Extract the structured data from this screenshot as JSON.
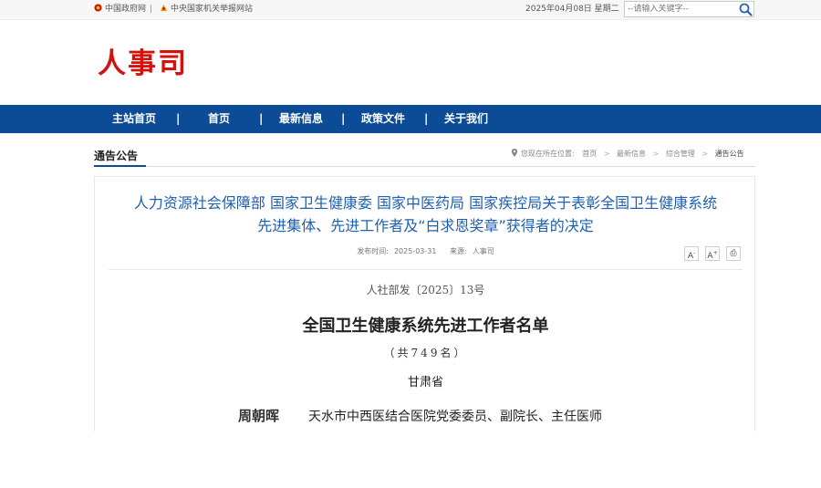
{
  "topbar": {
    "gov_link": "中国政府网",
    "separator": "|",
    "report_link": "中央国家机关举报网站",
    "date": "2025年04月08日 星期二",
    "search": {
      "placeholder": "--请输入关键字--"
    }
  },
  "header": {
    "logo_text": "人事司"
  },
  "nav": {
    "items": [
      {
        "label": "主站首页"
      },
      {
        "label": "首页"
      },
      {
        "label": "最新信息"
      },
      {
        "label": "政策文件"
      },
      {
        "label": "关于我们"
      }
    ],
    "separator": "|"
  },
  "section": {
    "title": "通告公告",
    "breadcrumb": {
      "prefix": "您现在所在位置:",
      "items": [
        "首页",
        "最新信息",
        "综合管理"
      ],
      "current": "通告公告",
      "arrow": ">"
    }
  },
  "article": {
    "title_line1": "人力资源社会保障部 国家卫生健康委 国家中医药局 国家疾控局关于表彰全国卫生健康系统",
    "title_line2": "先进集体、先进工作者及“白求恩奖章”获得者的决定",
    "published_label": "发布时间:",
    "published_date": "2025-03-31",
    "source_label": "来源:",
    "source": "人事司",
    "tools": {
      "decrease": "A",
      "increase": "A",
      "print": "⎙"
    },
    "doc_number": "人社部发〔2025〕13号",
    "list_title": "全国卫生健康系统先进工作者名单",
    "count": "（共749名）",
    "province": "甘肃省",
    "person": {
      "name": "周朝晖",
      "description": "天水市中西医结合医院党委委员、副院长、主任医师"
    }
  },
  "colors": {
    "nav_bg": "#0c4b95",
    "logo_red": "#d4120d",
    "title_blue": "#1f5fae"
  }
}
